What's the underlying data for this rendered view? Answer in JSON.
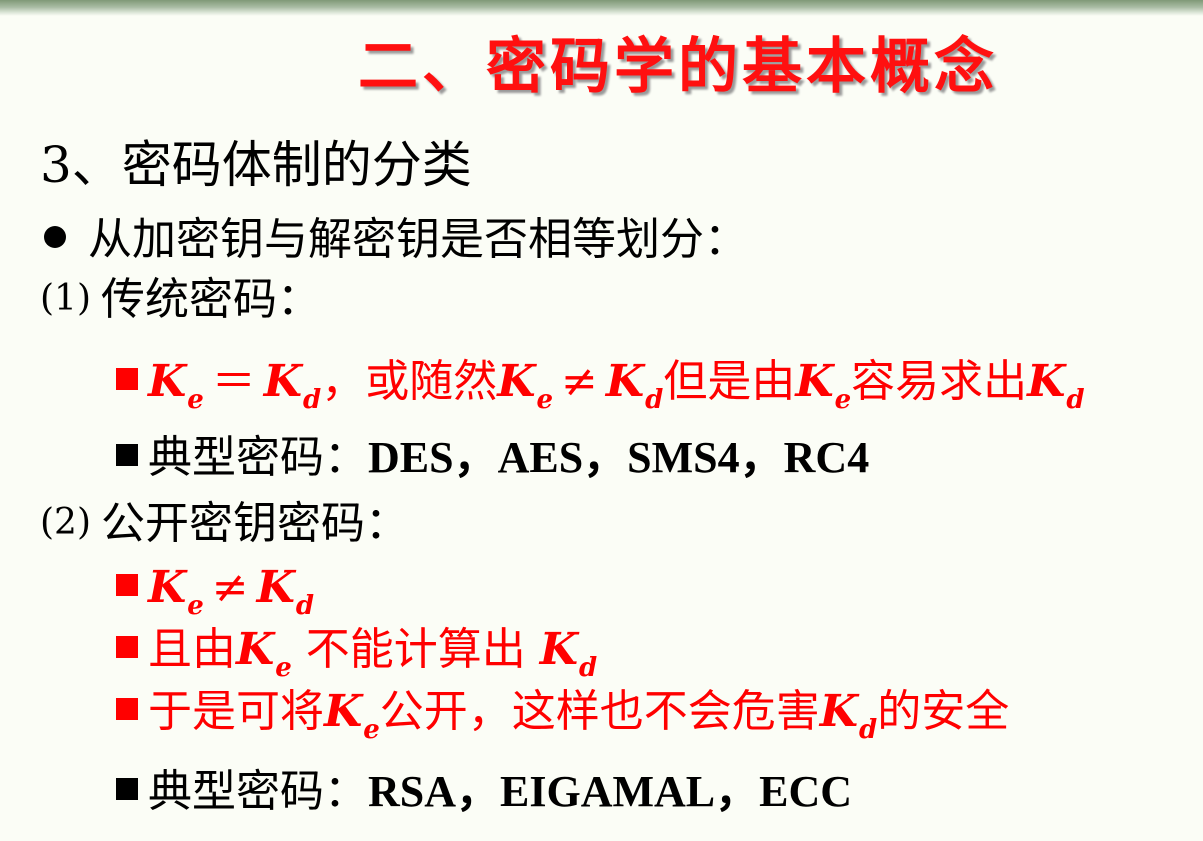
{
  "title": "二、密码学的基本概念",
  "section_heading": "3、密码体制的分类",
  "criterion": "从加密钥与解密钥是否相等划分：",
  "item1": {
    "num": "(1)",
    "label": "传统密码：",
    "line_a": {
      "K": "K",
      "e": "e",
      "d": "d",
      "eq": "＝",
      "sep1": "，或随然",
      "neq": "≠",
      "mid": "但是由",
      "end": "容易求出"
    },
    "line_b": {
      "prefix": "典型密码：",
      "algorithms": "DES，AES，SMS4，RC4"
    }
  },
  "item2": {
    "num": "(2)",
    "label": "公开密钥密码：",
    "line_a": {
      "neq": "≠"
    },
    "line_b": {
      "pre": "且由",
      "mid": " 不能计算出 "
    },
    "line_c": {
      "pre": "于是可将",
      "mid": "公开，这样也不会危害",
      "end": "的安全"
    },
    "line_d": {
      "prefix": "典型密码：",
      "algorithms": "RSA，EIGAMAL，ECC"
    }
  },
  "colors": {
    "title": "#ff1010",
    "emphasis": "#ff0000",
    "text": "#000000",
    "background": "#fbfdf6"
  },
  "icons": {
    "criterion_bullet": "filled-circle",
    "item_bullet": "filled-square"
  }
}
